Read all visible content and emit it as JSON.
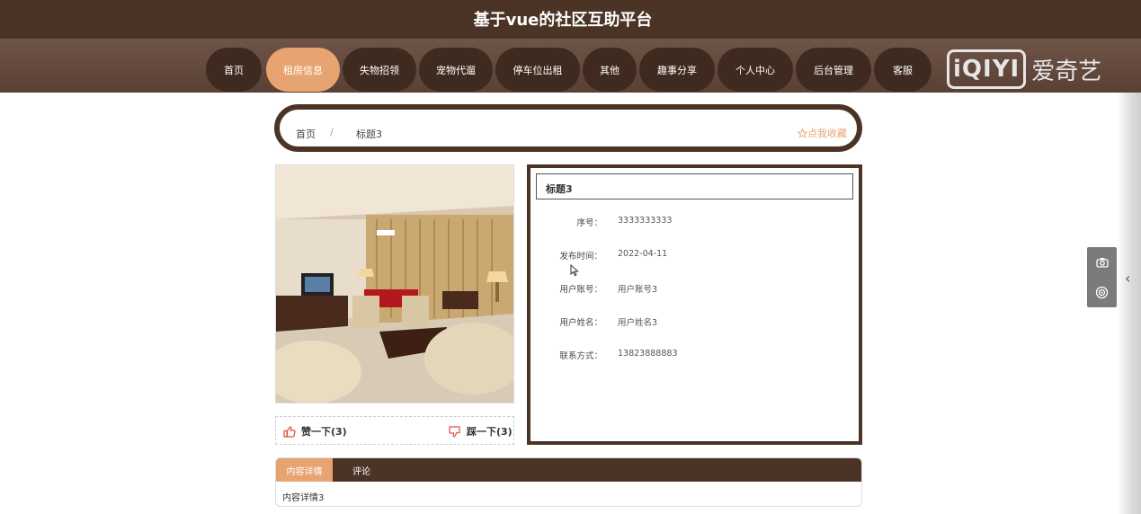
{
  "header": {
    "title": "基于vue的社区互助平台"
  },
  "nav": {
    "items": [
      {
        "label": "首页"
      },
      {
        "label": "租房信息"
      },
      {
        "label": "失物招领"
      },
      {
        "label": "宠物代遛"
      },
      {
        "label": "停车位出租"
      },
      {
        "label": "其他"
      },
      {
        "label": "趣事分享"
      },
      {
        "label": "个人中心"
      },
      {
        "label": "后台管理"
      },
      {
        "label": "客服"
      }
    ],
    "active_index": 1,
    "active_color": "#e8a470",
    "item_color": "#3f2a1f"
  },
  "watermark": {
    "logo_text": "iQIYI",
    "cn_text": "爱奇艺"
  },
  "breadcrumb": {
    "home": "首页",
    "separator": "/",
    "current": "标题3"
  },
  "favorite": {
    "label": "点我收藏",
    "icon": "star-outline-icon"
  },
  "votes": {
    "like": {
      "label": "赞一下(3)",
      "icon": "thumbs-up-icon"
    },
    "dislike": {
      "label": "踩一下(3)",
      "icon": "thumbs-down-icon"
    }
  },
  "detail": {
    "title": "标题3",
    "fields": [
      {
        "label": "序号：",
        "value": "3333333333"
      },
      {
        "label": "发布时间：",
        "value": "2022-04-11"
      },
      {
        "label": "用户账号：",
        "value": "用户账号3"
      },
      {
        "label": "用户姓名：",
        "value": "用户姓名3"
      },
      {
        "label": "联系方式：",
        "value": "13823888883"
      }
    ]
  },
  "tabs": {
    "items": [
      {
        "label": "内容详情"
      },
      {
        "label": "评论"
      }
    ],
    "active_index": 0,
    "content": "内容详情3"
  },
  "side_tools": {
    "icons": [
      "camera-icon",
      "target-icon"
    ]
  },
  "colors": {
    "brand_dark": "#4b3326",
    "accent": "#e8a470"
  }
}
